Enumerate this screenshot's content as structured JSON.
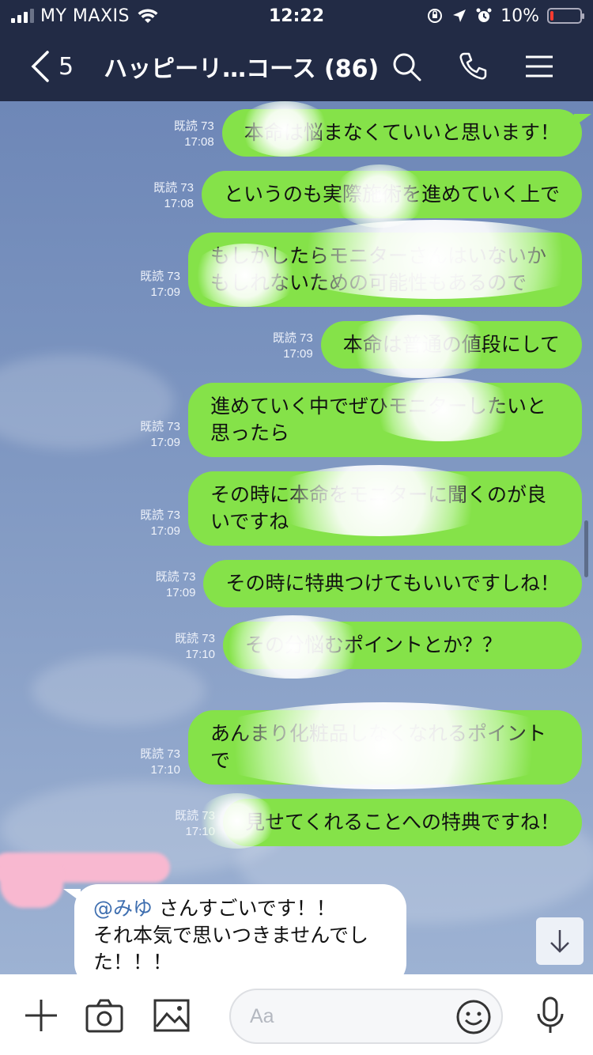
{
  "status_bar": {
    "carrier": "MY MAXIS",
    "time": "12:22",
    "battery": "10%",
    "battery_level": 0.1,
    "icons": [
      "signal-icon",
      "wifi-icon",
      "orientation-lock-icon",
      "location-icon",
      "alarm-icon",
      "battery-icon"
    ]
  },
  "header": {
    "back_count": "5",
    "title": "ハッピーリ…コース (86)",
    "icons": [
      "search-icon",
      "phone-icon",
      "menu-icon"
    ]
  },
  "messages": [
    {
      "read": "既読 73",
      "time": "17:08",
      "text": "本命は悩まなくていいと思います！"
    },
    {
      "read": "既読 73",
      "time": "17:08",
      "text": "というのも実際施術を進めていく上で"
    },
    {
      "read": "既読 73",
      "time": "17:09",
      "text": "もしかしたらモニターさんはいないかもしれないための可能性もあるので"
    },
    {
      "read": "既読 73",
      "time": "17:09",
      "text": "本命は普通の値段にして"
    },
    {
      "read": "既読 73",
      "time": "17:09",
      "text": "進めていく中でぜひモニターしたいと思ったら"
    },
    {
      "read": "既読 73",
      "time": "17:09",
      "text": "その時に本命をモニターに聞くのが良いですね"
    },
    {
      "read": "既読 73",
      "time": "17:09",
      "text": "その時に特典つけてもいいですしね！"
    },
    {
      "read": "既読 73",
      "time": "17:10",
      "text": "その分悩むポイントとか？？"
    },
    {
      "read": "既読 73",
      "time": "17:10",
      "text": "あんまり化粧品しなくなれるポイントで"
    },
    {
      "read": "既読 73",
      "time": "17:10",
      "text": "見せてくれることへの特典ですね！"
    }
  ],
  "incoming": {
    "mention": "@みゆ",
    "line1": " さんすごいです！！",
    "line2": "それ本気で思いつきませんでした！！！"
  },
  "input": {
    "placeholder": "Aa",
    "icons": [
      "plus-icon",
      "camera-icon",
      "image-icon",
      "emoji-icon",
      "microphone-icon"
    ]
  },
  "colors": {
    "header_bg": "#222b45",
    "bubble_green": "#85e249",
    "mention_blue": "#3f6fb0"
  }
}
